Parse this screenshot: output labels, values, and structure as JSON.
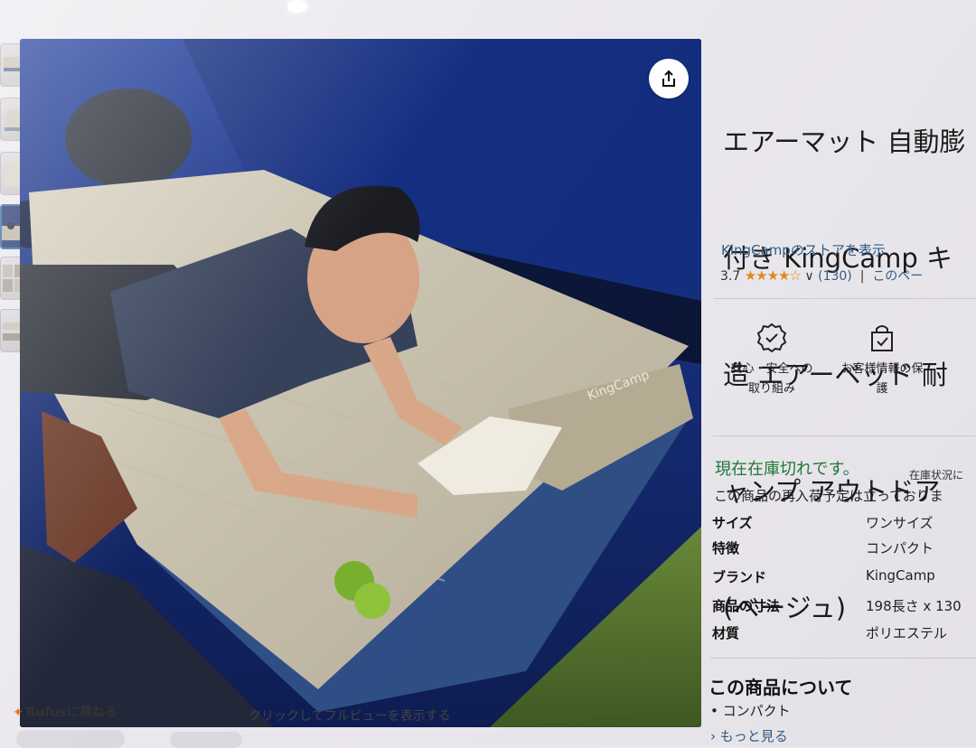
{
  "product": {
    "title_lines": [
      "エアーマット 自動膨",
      "付き KingCamp キ",
      "造 エアーベッド 耐",
      "ャンプ アウトドア",
      "(ベージュ)"
    ],
    "store_link": "KingCampのストアを表示",
    "rating_value": "3.7",
    "rating_stars": "★★★★☆",
    "rating_caret": "∨",
    "rating_count": "(130)",
    "rating_separator": "|",
    "rating_more": "このペー"
  },
  "badges": [
    {
      "label_lines": [
        "安心・安全への",
        "取り組み"
      ],
      "icon": "shield-check-icon"
    },
    {
      "label_lines": [
        "お客様情報の保",
        "護"
      ],
      "icon": "lock-bag-icon"
    }
  ],
  "availability": {
    "status": "現在在庫切れです。",
    "note": "在庫状況に",
    "restock": "この商品の再入荷予定は立っておりま"
  },
  "specs": [
    {
      "key": "サイズ",
      "value": "ワンサイズ"
    },
    {
      "key": "特徴",
      "value": "コンパクト"
    },
    {
      "key": "ブランド",
      "value": "KingCamp"
    },
    {
      "key": "商品の寸法",
      "value": "198長さ x 130"
    },
    {
      "key": "材質",
      "value": "ポリエステル"
    }
  ],
  "about": {
    "title": "この商品について",
    "bullet": "•  コンパクト",
    "see_more": "› もっと見る"
  },
  "media": {
    "caption": "クリックしてフルビューを表示する",
    "share_icon": "share-icon",
    "pillow_text": "KingCamp"
  },
  "assistant": {
    "label": "Rufusに尋ねる",
    "icon": "sparkle-icon"
  },
  "colors": {
    "link": "#315e8a",
    "in_stock_green": "#1f7a3a",
    "star_orange": "#e68a1a"
  }
}
